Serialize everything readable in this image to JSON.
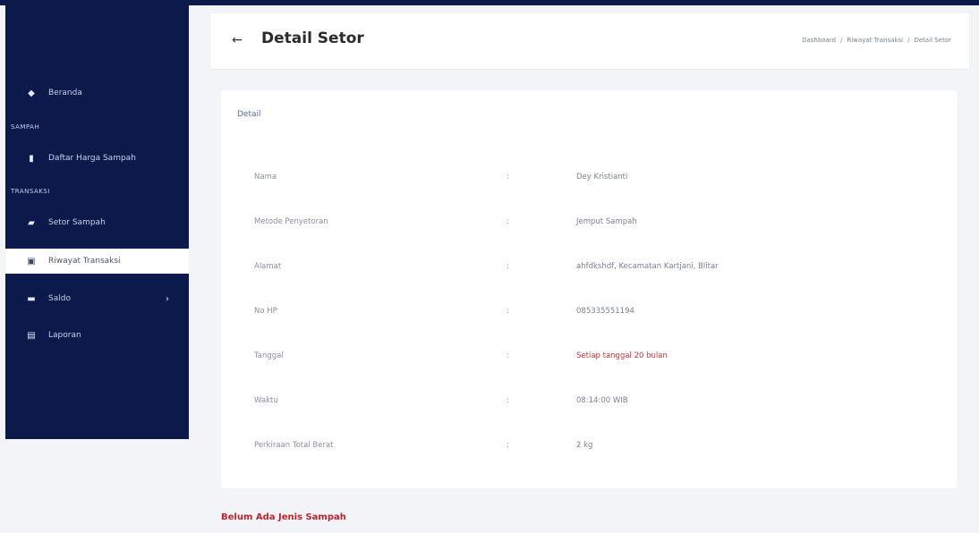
{
  "sidebar": {
    "items": [
      {
        "label": "Beranda",
        "icon": "home-icon"
      },
      {
        "label": "Daftar Harga Sampah",
        "icon": "trash-icon"
      },
      {
        "label": "Setor Sampah",
        "icon": "truck-icon"
      },
      {
        "label": "Riwayat Transaksi",
        "icon": "history-icon"
      },
      {
        "label": "Saldo",
        "icon": "wallet-icon"
      },
      {
        "label": "Laporan",
        "icon": "report-icon"
      }
    ],
    "sections": [
      "SAMPAH",
      "TRANSAKSI"
    ],
    "chevron": "›"
  },
  "header": {
    "back": "←",
    "title": "Detail Setor",
    "breadcrumb": [
      "Dashboard",
      "Riwayat Transaksi",
      "Detail Setor"
    ],
    "separator": "/"
  },
  "detail": {
    "title": "Detail",
    "colon": ":",
    "rows": [
      {
        "label": "Nama",
        "value": "Dey Kristianti"
      },
      {
        "label": "Metode Penyetoran",
        "value": "Jemput Sampah"
      },
      {
        "label": "Alamat",
        "value": "ahfdkshdf, Kecamatan Kartjani, Blitar"
      },
      {
        "label": "No HP",
        "value": "085335551194"
      },
      {
        "label": "Tanggal",
        "value": "Setiap tanggal 20 bulan"
      },
      {
        "label": "Waktu",
        "value": "08:14:00 WIB"
      },
      {
        "label": "Perkiraan Total Berat",
        "value": "2 kg"
      }
    ]
  },
  "empty_note": "Belum Ada Jenis Sampah",
  "colors": {
    "sidebar": "#0b1a4a",
    "accent": "#5a64a8",
    "alert": "#d0303b"
  }
}
